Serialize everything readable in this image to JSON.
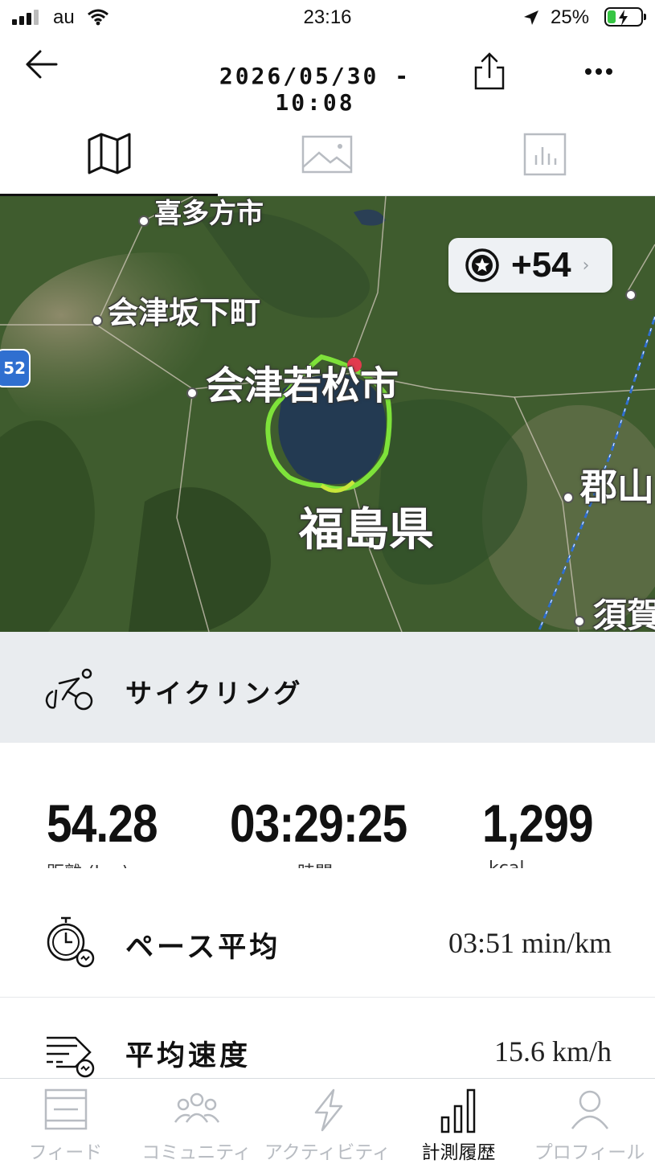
{
  "status_bar": {
    "carrier": "au",
    "time": "23:16",
    "battery_percent": "25%",
    "battery_level": 0.25,
    "signal_bars": 3
  },
  "header": {
    "title": "2026/05/30 - 10:08",
    "back_icon": "arrow-left-icon",
    "share_icon": "share-icon",
    "more_icon": "more-dots-icon"
  },
  "tabs": [
    {
      "id": "map",
      "icon": "map-icon",
      "active": true
    },
    {
      "id": "photos",
      "icon": "image-icon",
      "active": false
    },
    {
      "id": "charts",
      "icon": "bar-chart-icon",
      "active": false
    }
  ],
  "map": {
    "labels": {
      "kitakata": "喜多方市",
      "aizubange": "会津坂下町",
      "aizuwakamatsu": "会津若松市",
      "fukushima_ken": "福島県",
      "koriyama": "郡山",
      "sukagawa": "須賀",
      "route_number": "52"
    },
    "badge": {
      "icon": "star-badge-icon",
      "value": "+54"
    },
    "colors": {
      "route": "#7ee23a",
      "start_marker": "#e23a4e",
      "rail": "#2f6fd0"
    }
  },
  "activity": {
    "icon": "cycling-icon",
    "label": "サイクリング"
  },
  "stats": [
    {
      "value": "54.28",
      "label": "距離 (km)"
    },
    {
      "value": "03:29:25",
      "label": "時間"
    },
    {
      "value": "1,299",
      "label": "kcal"
    }
  ],
  "details": [
    {
      "icon": "stopwatch-icon",
      "label": "ペース平均",
      "value": "03:51 min/km"
    },
    {
      "icon": "speed-icon",
      "label": "平均速度",
      "value": "15.6 km/h"
    }
  ],
  "bottom_nav": [
    {
      "icon": "feed-icon",
      "label": "フィード",
      "active": false
    },
    {
      "icon": "community-icon",
      "label": "コミュニティ",
      "active": false
    },
    {
      "icon": "lightning-icon",
      "label": "アクティビティ",
      "active": false
    },
    {
      "icon": "history-chart-icon",
      "label": "計測履歴",
      "active": true
    },
    {
      "icon": "profile-icon",
      "label": "プロフィール",
      "active": false
    }
  ]
}
